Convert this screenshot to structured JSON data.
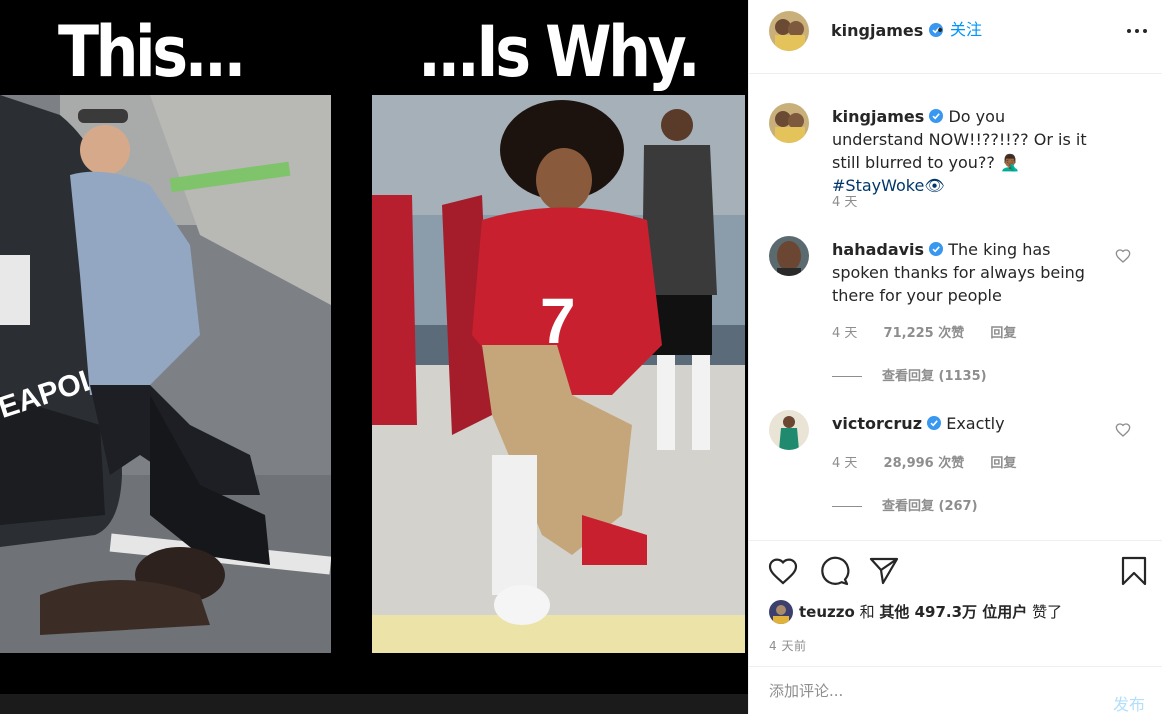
{
  "post": {
    "media_caption_left": "This...",
    "media_caption_right": "...Is Why.",
    "photo_left_text": "EAPOLIS",
    "photo_right_number": "7"
  },
  "header": {
    "username": "kingjames",
    "dot": "•",
    "follow_label": "关注",
    "more_icon": "more-options-icon"
  },
  "comments": [
    {
      "username": "kingjames",
      "text": "Do you understand NOW!!??!!?? Or is it still blurred to you?? ",
      "emoji": "🤦🏾‍♂️",
      "hashtag": "#StayWoke",
      "eye": "👁",
      "time": "4 天"
    },
    {
      "username": "hahadavis",
      "text": "The king has spoken thanks for always being there for your people",
      "time": "4 天",
      "likes": "71,225 次赞",
      "reply_label": "回复",
      "view_replies": "查看回复 (1135)"
    },
    {
      "username": "victorcruz",
      "text": "Exactly",
      "time": "4 天",
      "likes": "28,996 次赞",
      "reply_label": "回复",
      "view_replies": "查看回复 (267)"
    }
  ],
  "likes_line": {
    "liker": "teuzzo",
    "and": "和",
    "others": "其他 497.3万 位用户",
    "liked": "赞了"
  },
  "timestamp": "4 天前",
  "add_comment": {
    "placeholder": "添加评论...",
    "post_label": "发布"
  },
  "colors": {
    "link_blue": "#0095f6",
    "hashtag": "#00376b",
    "muted": "#8e8e8e",
    "post_disabled": "#b2dffc",
    "verified": "#3897f0"
  }
}
